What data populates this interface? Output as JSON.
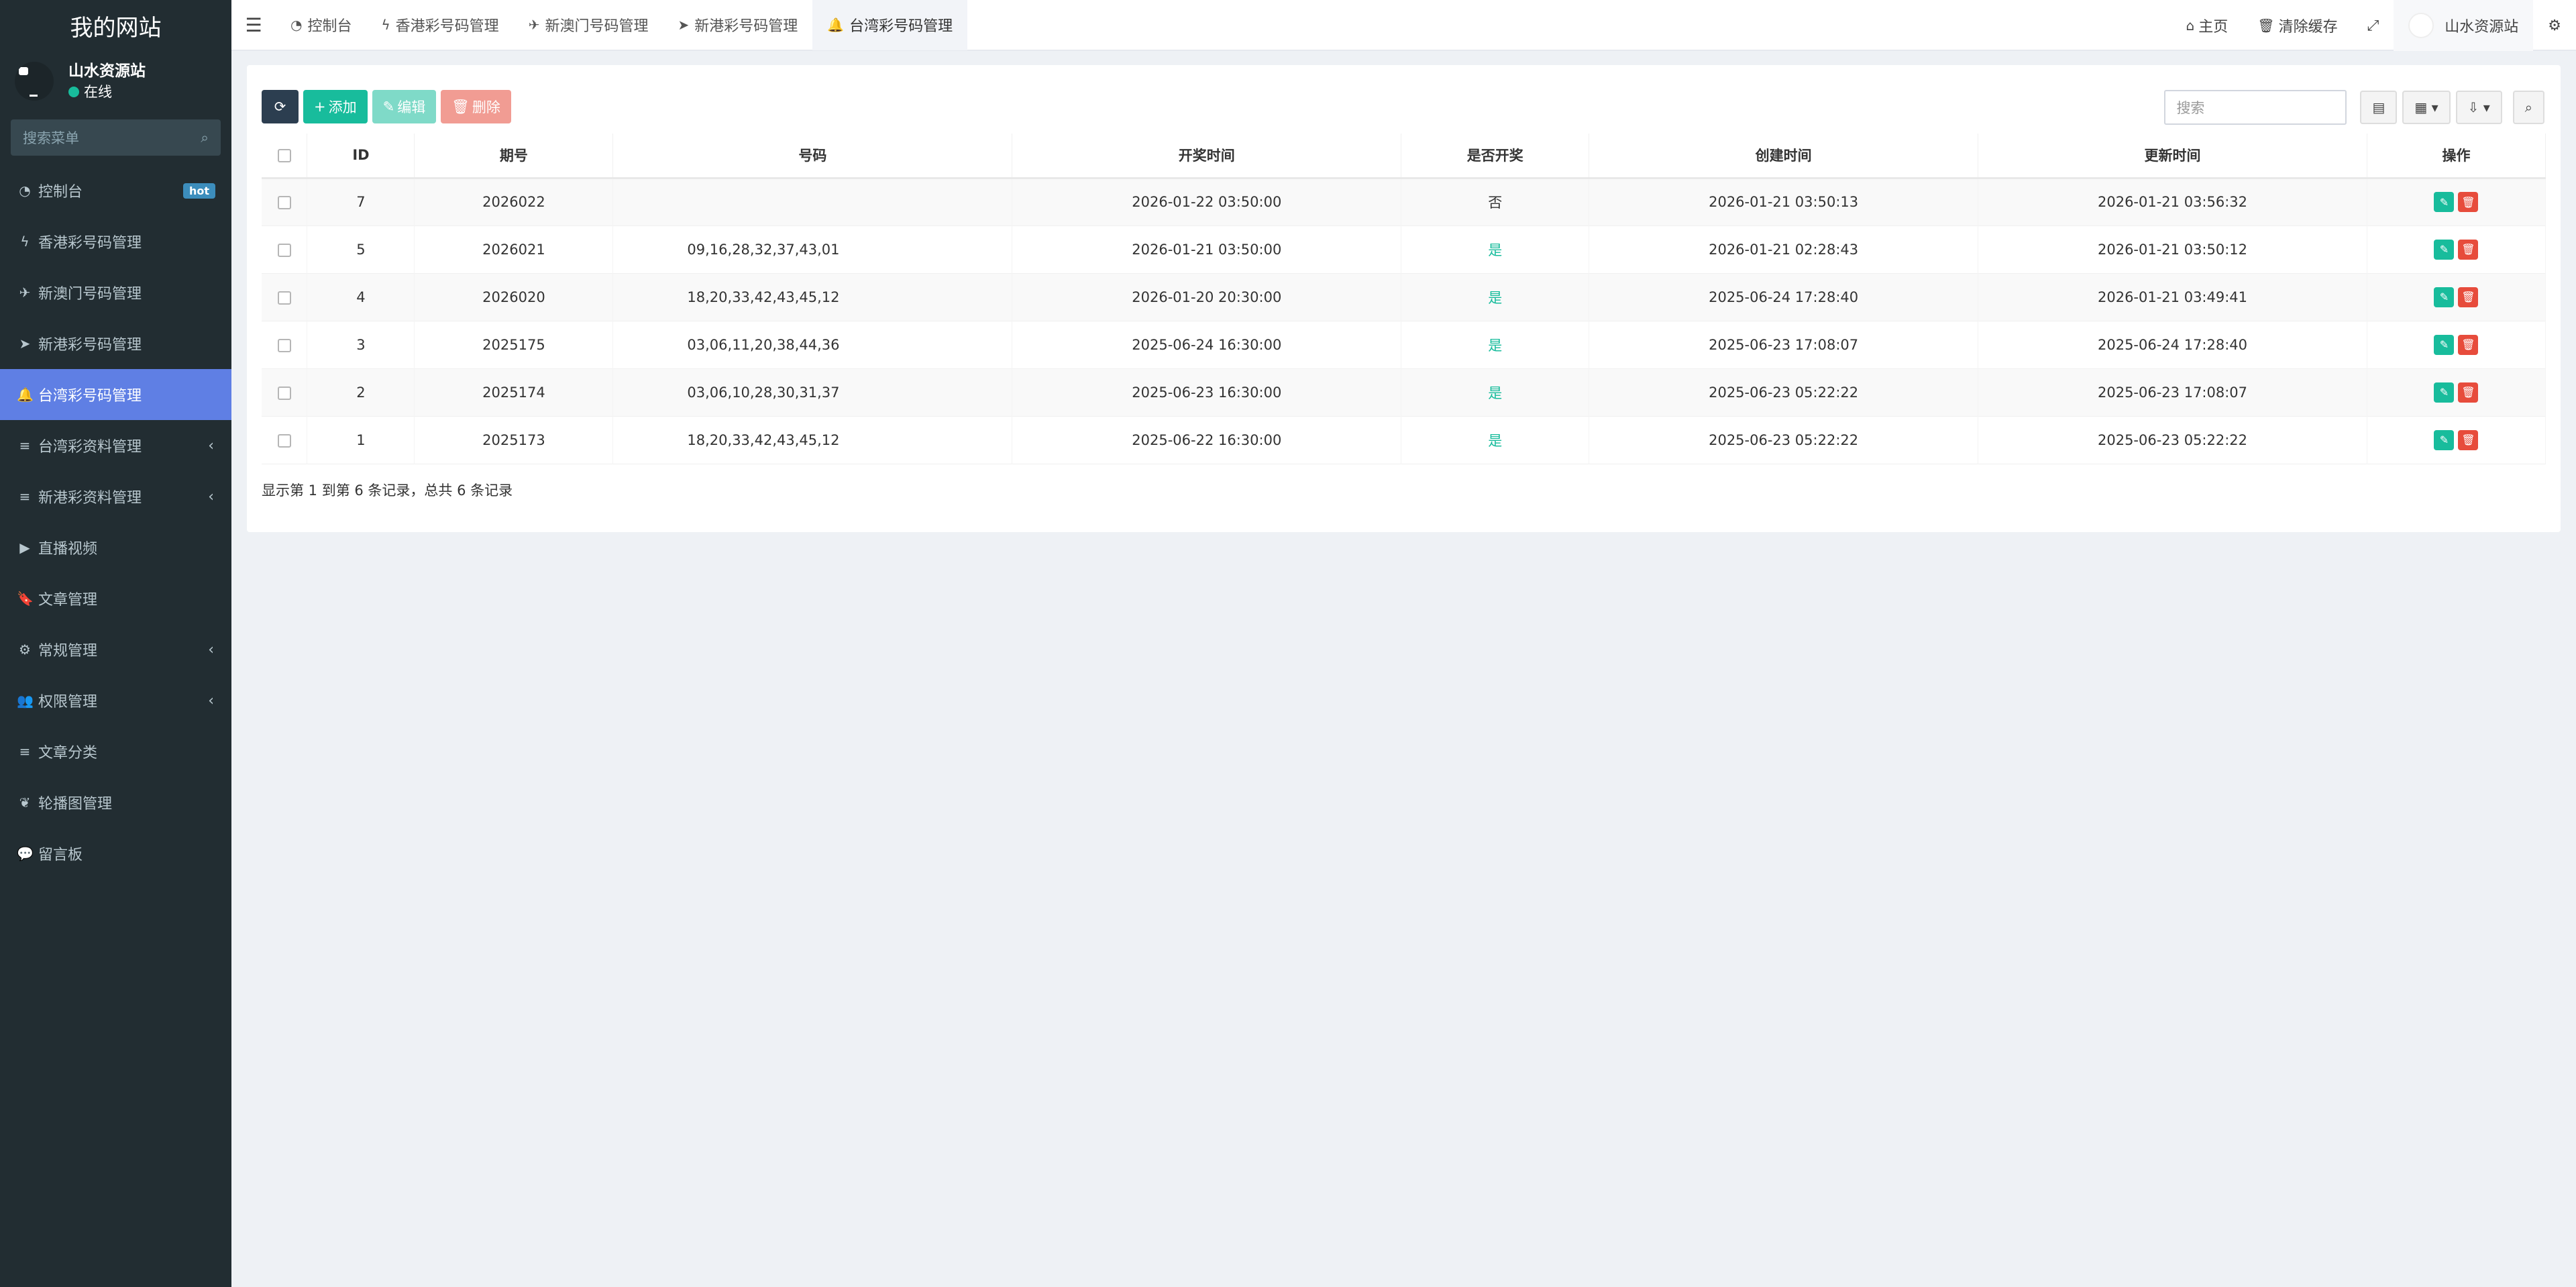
{
  "brand": "我的网站",
  "user": {
    "name": "山水资源站",
    "status": "在线"
  },
  "sidebar_search_placeholder": "搜索菜单",
  "menu": [
    {
      "label": "控制台",
      "badge": "hot",
      "icon": "dashboard-icon"
    },
    {
      "label": "香港彩号码管理",
      "icon": "bolt-icon"
    },
    {
      "label": "新澳门号码管理",
      "icon": "plane-icon"
    },
    {
      "label": "新港彩号码管理",
      "icon": "location-arrow-icon"
    },
    {
      "label": "台湾彩号码管理",
      "icon": "bell-icon",
      "active": true
    },
    {
      "label": "台湾彩资料管理",
      "icon": "list-icon",
      "chevron": "‹"
    },
    {
      "label": "新港彩资料管理",
      "icon": "list-icon",
      "chevron": "‹"
    },
    {
      "label": "直播视频",
      "icon": "video-icon"
    },
    {
      "label": "文章管理",
      "icon": "bookmark-icon"
    },
    {
      "label": "常规管理",
      "icon": "cogs-icon",
      "chevron": "‹"
    },
    {
      "label": "权限管理",
      "icon": "users-icon",
      "chevron": "‹"
    },
    {
      "label": "文章分类",
      "icon": "list-icon"
    },
    {
      "label": "轮播图管理",
      "icon": "leaf-icon"
    },
    {
      "label": "留言板",
      "icon": "comment-icon"
    }
  ],
  "tabs": [
    {
      "label": "控制台",
      "icon": "dashboard-icon"
    },
    {
      "label": "香港彩号码管理",
      "icon": "bolt-icon"
    },
    {
      "label": "新澳门号码管理",
      "icon": "plane-icon"
    },
    {
      "label": "新港彩号码管理",
      "icon": "location-arrow-icon"
    },
    {
      "label": "台湾彩号码管理",
      "icon": "bell-icon",
      "active": true
    }
  ],
  "topright": {
    "home": "主页",
    "clear_cache": "清除缓存",
    "user": "山水资源站"
  },
  "toolbar": {
    "add": "添加",
    "edit": "编辑",
    "delete": "删除"
  },
  "search_placeholder": "搜索",
  "table": {
    "headers": [
      "ID",
      "期号",
      "号码",
      "开奖时间",
      "是否开奖",
      "创建时间",
      "更新时间",
      "操作"
    ],
    "rows": [
      {
        "id": "7",
        "issue": "2026022",
        "numbers": "",
        "draw_time": "2026-01-22 03:50:00",
        "drawn": "否",
        "created": "2026-01-21 03:50:13",
        "updated": "2026-01-21 03:56:32"
      },
      {
        "id": "5",
        "issue": "2026021",
        "numbers": "09,16,28,32,37,43,01",
        "draw_time": "2026-01-21 03:50:00",
        "drawn": "是",
        "created": "2026-01-21 02:28:43",
        "updated": "2026-01-21 03:50:12"
      },
      {
        "id": "4",
        "issue": "2026020",
        "numbers": "18,20,33,42,43,45,12",
        "draw_time": "2026-01-20 20:30:00",
        "drawn": "是",
        "created": "2025-06-24 17:28:40",
        "updated": "2026-01-21 03:49:41"
      },
      {
        "id": "3",
        "issue": "2025175",
        "numbers": "03,06,11,20,38,44,36",
        "draw_time": "2025-06-24 16:30:00",
        "drawn": "是",
        "created": "2025-06-23 17:08:07",
        "updated": "2025-06-24 17:28:40"
      },
      {
        "id": "2",
        "issue": "2025174",
        "numbers": "03,06,10,28,30,31,37",
        "draw_time": "2025-06-23 16:30:00",
        "drawn": "是",
        "created": "2025-06-23 05:22:22",
        "updated": "2025-06-23 17:08:07"
      },
      {
        "id": "1",
        "issue": "2025173",
        "numbers": "18,20,33,42,43,45,12",
        "draw_time": "2025-06-22 16:30:00",
        "drawn": "是",
        "created": "2025-06-23 05:22:22",
        "updated": "2025-06-23 05:22:22"
      }
    ]
  },
  "page_info": "显示第 1 到第 6 条记录，总共 6 条记录",
  "colors": {
    "sidebar": "#222d32",
    "active": "#5f7fe4",
    "success": "#18bc9c",
    "danger": "#e74c3c",
    "dark": "#2c3e50"
  }
}
